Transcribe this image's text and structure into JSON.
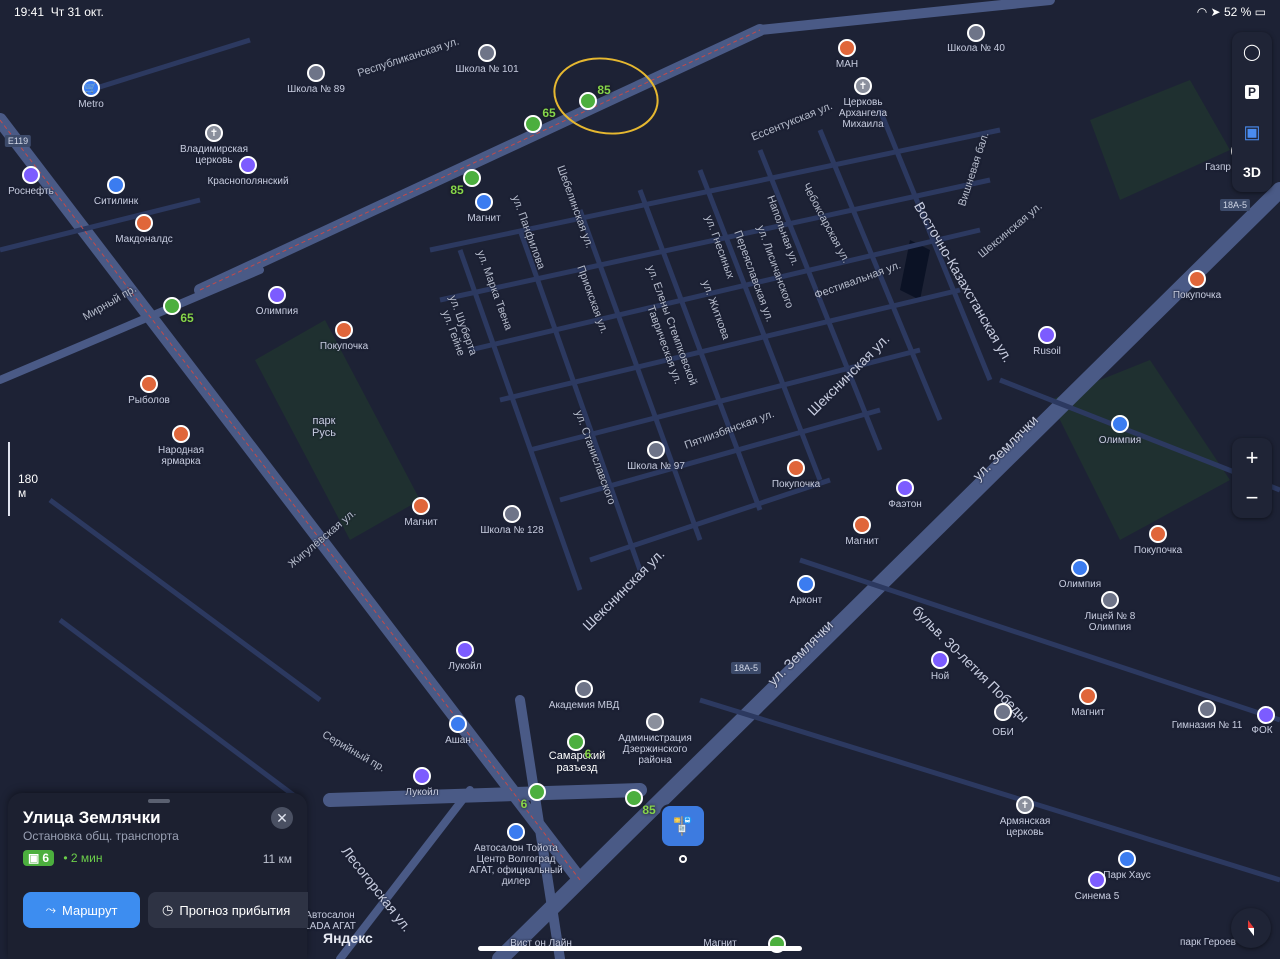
{
  "status_bar": {
    "time": "19:41",
    "date": "Чт 31 окт.",
    "battery": "52 %"
  },
  "map_controls": {
    "parking": "P",
    "mode_3d": "3D",
    "zoom_in": "+",
    "zoom_out": "−"
  },
  "scale": "180 м",
  "stop_card": {
    "title": "Улица Землячки",
    "subtitle": "Остановка общ. транспорта",
    "bus_route": "6",
    "eta": "• 2 мин",
    "distance": "11 км",
    "route_button": "Маршрут",
    "forecast_button": "Прогноз прибытия"
  },
  "brand": "Яндекс",
  "streets": [
    "Республиканская ул.",
    "Ессентукская ул.",
    "Чебоксарская ул.",
    "ул. Панфилова",
    "Шебелинская ул.",
    "ул. Марка Твена",
    "ул. Шуберта",
    "ул. Гейне",
    "Приокская ул.",
    "ул. Елены Стемпковской",
    "Таврическая ул.",
    "ул. Житкова",
    "ул. Гнесиных",
    "Переяславская ул.",
    "ул. Лисичанского",
    "Напольная ул.",
    "Фестивальная ул.",
    "Восточно-Казахстанская ул.",
    "Вишневая бал.",
    "Шексинская ул.",
    "Шекснинская ул.",
    "Пятиизбянская ул.",
    "ул. Землячки",
    "бульв. 30-летия Победы",
    "Жигулёвская ул.",
    "Лесогорская ул.",
    "Мирный пр.",
    "ул. Станиславского",
    "Серийный пр.",
    "ул. Шуберта"
  ],
  "road_badges": [
    "E119",
    "18A-5",
    "18A-5"
  ],
  "pois": [
    "Metro",
    "Школа № 89",
    "Школа № 101",
    "МАН",
    "Школа № 40",
    "Церковь Архангела Михаила",
    "Владимирская церковь",
    "Краснополянский",
    "Роснефть",
    "Ситилинк",
    "Макдоналдс",
    "Магнит",
    "Олимпия",
    "Покупочка",
    "Рыболов",
    "Народная ярмарка",
    "парк Русь",
    "Школа № 97",
    "Школа № 128",
    "Фаэтон",
    "Магнит",
    "Покупочка",
    "Олимпия",
    "Rusoil",
    "Покупочка",
    "Газпр",
    "Арконт",
    "Олимпия",
    "Лицей № 8 Олимпия",
    "Магнит",
    "Ной",
    "ОБИ",
    "Гимназия № 11",
    "ФОК",
    "Лукойл",
    "Ашан",
    "Академия МВД",
    "Администрация Дзержинского района",
    "Самарский разъезд",
    "Лукойл",
    "Автосалон Тойота Центр Волгоград АГАТ, официальный дилер",
    "Армянская церковь",
    "Парк Хаус",
    "Синема 5",
    "парк Героев",
    "Автосалон LADA АГАТ",
    "Вист он Лайн",
    "Магнит",
    "Магнит",
    "Покупочка"
  ],
  "route_labels": [
    "85",
    "65",
    "85",
    "65",
    "6",
    "6",
    "85",
    "65"
  ]
}
